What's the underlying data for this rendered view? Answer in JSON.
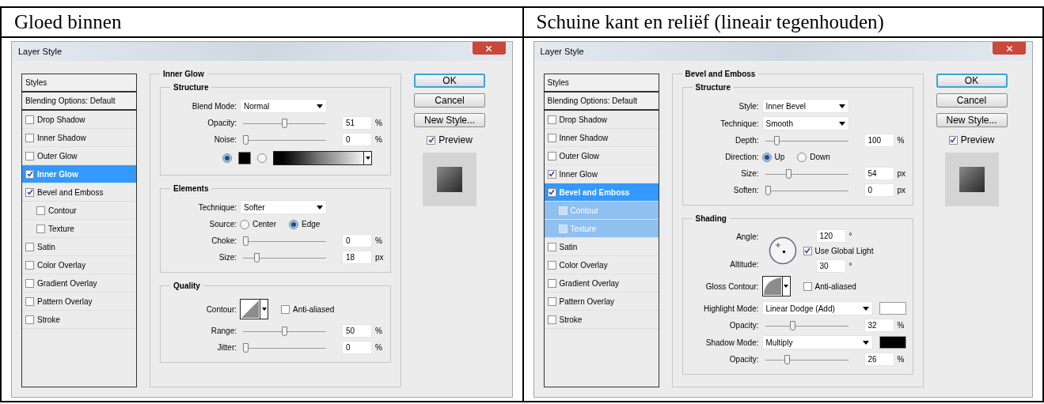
{
  "panels": [
    {
      "heading": "Gloed binnen",
      "dialog": {
        "title": "Layer Style",
        "styles": [
          {
            "label": "Styles",
            "kind": "header"
          },
          {
            "label": "Blending Options: Default",
            "kind": "header"
          },
          {
            "label": "Drop Shadow",
            "kind": "option",
            "checked": false,
            "selected": false
          },
          {
            "label": "Inner Shadow",
            "kind": "option",
            "checked": false,
            "selected": false
          },
          {
            "label": "Outer Glow",
            "kind": "option",
            "checked": false,
            "selected": false
          },
          {
            "label": "Inner Glow",
            "kind": "option",
            "checked": true,
            "selected": true
          },
          {
            "label": "Bevel and Emboss",
            "kind": "option",
            "checked": true,
            "selected": false,
            "children": [
              {
                "label": "Contour",
                "checked": false
              },
              {
                "label": "Texture",
                "checked": false
              }
            ]
          },
          {
            "label": "Satin",
            "kind": "option",
            "checked": false,
            "selected": false
          },
          {
            "label": "Color Overlay",
            "kind": "option",
            "checked": false,
            "selected": false
          },
          {
            "label": "Gradient Overlay",
            "kind": "option",
            "checked": false,
            "selected": false
          },
          {
            "label": "Pattern Overlay",
            "kind": "option",
            "checked": false,
            "selected": false
          },
          {
            "label": "Stroke",
            "kind": "option",
            "checked": false,
            "selected": false
          }
        ],
        "section": {
          "title": "Inner Glow",
          "groups": [
            {
              "title": "Structure",
              "rows": [
                {
                  "kind": "select",
                  "label": "Blend Mode:",
                  "value": "Normal"
                },
                {
                  "kind": "slider",
                  "label": "Opacity:",
                  "level": 0.5,
                  "value": "51",
                  "unit": "%"
                },
                {
                  "kind": "slider",
                  "label": "Noise:",
                  "level": 0,
                  "value": "0",
                  "unit": "%"
                },
                {
                  "kind": "fill",
                  "options": [
                    {
                      "kind": "color",
                      "selected": true
                    },
                    {
                      "kind": "gradient",
                      "selected": false
                    }
                  ]
                }
              ]
            },
            {
              "title": "Elements",
              "rows": [
                {
                  "kind": "select",
                  "label": "Technique:",
                  "value": "Softer"
                },
                {
                  "kind": "radio",
                  "label": "Source:",
                  "options": [
                    {
                      "label": "Center",
                      "selected": false
                    },
                    {
                      "label": "Edge",
                      "selected": true
                    }
                  ]
                },
                {
                  "kind": "slider",
                  "label": "Choke:",
                  "level": 0,
                  "value": "0",
                  "unit": "%"
                },
                {
                  "kind": "slider",
                  "label": "Size:",
                  "level": 0.14,
                  "value": "18",
                  "unit": "px"
                }
              ]
            },
            {
              "title": "Quality",
              "rows": [
                {
                  "kind": "contour",
                  "label": "Contour:",
                  "curve": {
                    "kind": "linear"
                  },
                  "checkbox": {
                    "label": "Anti-aliased",
                    "checked": false
                  }
                },
                {
                  "kind": "slider",
                  "label": "Range:",
                  "level": 0.5,
                  "value": "50",
                  "unit": "%"
                },
                {
                  "kind": "slider",
                  "label": "Jitter:",
                  "level": 0,
                  "value": "0",
                  "unit": "%"
                }
              ]
            }
          ]
        },
        "buttons": [
          {
            "label": "OK",
            "default": true
          },
          {
            "label": "Cancel",
            "default": false
          },
          {
            "label": "New Style...",
            "default": false
          }
        ],
        "preview": {
          "label": "Preview",
          "checked": true
        }
      }
    },
    {
      "heading": "Schuine kant en reliëf (lineair tegenhouden)",
      "dialog": {
        "title": "Layer Style",
        "styles": [
          {
            "label": "Styles",
            "kind": "header"
          },
          {
            "label": "Blending Options: Default",
            "kind": "header"
          },
          {
            "label": "Drop Shadow",
            "kind": "option",
            "checked": false,
            "selected": false
          },
          {
            "label": "Inner Shadow",
            "kind": "option",
            "checked": false,
            "selected": false
          },
          {
            "label": "Outer Glow",
            "kind": "option",
            "checked": false,
            "selected": false
          },
          {
            "label": "Inner Glow",
            "kind": "option",
            "checked": true,
            "selected": false
          },
          {
            "label": "Bevel and Emboss",
            "kind": "option",
            "checked": true,
            "selected": true,
            "children": [
              {
                "label": "Contour",
                "checked": false
              },
              {
                "label": "Texture",
                "checked": false
              }
            ]
          },
          {
            "label": "Satin",
            "kind": "option",
            "checked": false,
            "selected": false
          },
          {
            "label": "Color Overlay",
            "kind": "option",
            "checked": false,
            "selected": false
          },
          {
            "label": "Gradient Overlay",
            "kind": "option",
            "checked": false,
            "selected": false
          },
          {
            "label": "Pattern Overlay",
            "kind": "option",
            "checked": false,
            "selected": false
          },
          {
            "label": "Stroke",
            "kind": "option",
            "checked": false,
            "selected": false
          }
        ],
        "section": {
          "title": "Bevel and Emboss",
          "groups": [
            {
              "title": "Structure",
              "rows": [
                {
                  "kind": "select",
                  "label": "Style:",
                  "value": "Inner Bevel"
                },
                {
                  "kind": "select",
                  "label": "Technique:",
                  "value": "Smooth"
                },
                {
                  "kind": "slider",
                  "label": "Depth:",
                  "level": 0.12,
                  "value": "100",
                  "unit": "%"
                },
                {
                  "kind": "radio",
                  "label": "Direction:",
                  "options": [
                    {
                      "label": "Up",
                      "selected": true
                    },
                    {
                      "label": "Down",
                      "selected": false
                    }
                  ]
                },
                {
                  "kind": "slider",
                  "label": "Size:",
                  "level": 0.27,
                  "value": "54",
                  "unit": "px"
                },
                {
                  "kind": "slider",
                  "label": "Soften:",
                  "level": 0,
                  "value": "0",
                  "unit": "px"
                }
              ]
            },
            {
              "title": "Shading",
              "rows": [
                {
                  "kind": "angle",
                  "label": "Angle:",
                  "value": "120",
                  "unit": "°",
                  "checkbox": {
                    "label": "Use Global Light",
                    "checked": true
                  },
                  "altitude_label": "Altitude:",
                  "altitude": "30",
                  "altitude_unit": "°"
                },
                {
                  "kind": "contour",
                  "label": "Gloss Contour:",
                  "curve": {
                    "kind": "rounded"
                  },
                  "checkbox": {
                    "label": "Anti-aliased",
                    "checked": false
                  }
                },
                {
                  "kind": "select",
                  "label": "Highlight Mode:",
                  "value": "Linear Dodge (Add)",
                  "color": "#ffffff"
                },
                {
                  "kind": "slider",
                  "label": "Opacity:",
                  "level": 0.32,
                  "value": "32",
                  "unit": "%"
                },
                {
                  "kind": "select",
                  "label": "Shadow Mode:",
                  "value": "Multiply",
                  "color": "#000000"
                },
                {
                  "kind": "slider",
                  "label": "Opacity:",
                  "level": 0.25,
                  "value": "26",
                  "unit": "%"
                }
              ]
            }
          ]
        },
        "buttons": [
          {
            "label": "OK",
            "default": true
          },
          {
            "label": "Cancel",
            "default": false
          },
          {
            "label": "New Style...",
            "default": false
          }
        ],
        "preview": {
          "label": "Preview",
          "checked": true
        }
      }
    }
  ]
}
